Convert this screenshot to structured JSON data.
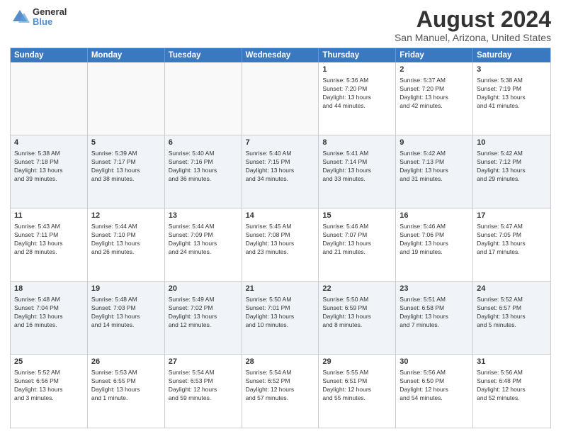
{
  "logo": {
    "line1": "General",
    "line2": "Blue"
  },
  "title": "August 2024",
  "location": "San Manuel, Arizona, United States",
  "header_days": [
    "Sunday",
    "Monday",
    "Tuesday",
    "Wednesday",
    "Thursday",
    "Friday",
    "Saturday"
  ],
  "weeks": [
    [
      {
        "day": "",
        "info": "",
        "empty": true
      },
      {
        "day": "",
        "info": "",
        "empty": true
      },
      {
        "day": "",
        "info": "",
        "empty": true
      },
      {
        "day": "",
        "info": "",
        "empty": true
      },
      {
        "day": "1",
        "info": "Sunrise: 5:36 AM\nSunset: 7:20 PM\nDaylight: 13 hours\nand 44 minutes."
      },
      {
        "day": "2",
        "info": "Sunrise: 5:37 AM\nSunset: 7:20 PM\nDaylight: 13 hours\nand 42 minutes."
      },
      {
        "day": "3",
        "info": "Sunrise: 5:38 AM\nSunset: 7:19 PM\nDaylight: 13 hours\nand 41 minutes."
      }
    ],
    [
      {
        "day": "4",
        "info": "Sunrise: 5:38 AM\nSunset: 7:18 PM\nDaylight: 13 hours\nand 39 minutes."
      },
      {
        "day": "5",
        "info": "Sunrise: 5:39 AM\nSunset: 7:17 PM\nDaylight: 13 hours\nand 38 minutes."
      },
      {
        "day": "6",
        "info": "Sunrise: 5:40 AM\nSunset: 7:16 PM\nDaylight: 13 hours\nand 36 minutes."
      },
      {
        "day": "7",
        "info": "Sunrise: 5:40 AM\nSunset: 7:15 PM\nDaylight: 13 hours\nand 34 minutes."
      },
      {
        "day": "8",
        "info": "Sunrise: 5:41 AM\nSunset: 7:14 PM\nDaylight: 13 hours\nand 33 minutes."
      },
      {
        "day": "9",
        "info": "Sunrise: 5:42 AM\nSunset: 7:13 PM\nDaylight: 13 hours\nand 31 minutes."
      },
      {
        "day": "10",
        "info": "Sunrise: 5:42 AM\nSunset: 7:12 PM\nDaylight: 13 hours\nand 29 minutes."
      }
    ],
    [
      {
        "day": "11",
        "info": "Sunrise: 5:43 AM\nSunset: 7:11 PM\nDaylight: 13 hours\nand 28 minutes."
      },
      {
        "day": "12",
        "info": "Sunrise: 5:44 AM\nSunset: 7:10 PM\nDaylight: 13 hours\nand 26 minutes."
      },
      {
        "day": "13",
        "info": "Sunrise: 5:44 AM\nSunset: 7:09 PM\nDaylight: 13 hours\nand 24 minutes."
      },
      {
        "day": "14",
        "info": "Sunrise: 5:45 AM\nSunset: 7:08 PM\nDaylight: 13 hours\nand 23 minutes."
      },
      {
        "day": "15",
        "info": "Sunrise: 5:46 AM\nSunset: 7:07 PM\nDaylight: 13 hours\nand 21 minutes."
      },
      {
        "day": "16",
        "info": "Sunrise: 5:46 AM\nSunset: 7:06 PM\nDaylight: 13 hours\nand 19 minutes."
      },
      {
        "day": "17",
        "info": "Sunrise: 5:47 AM\nSunset: 7:05 PM\nDaylight: 13 hours\nand 17 minutes."
      }
    ],
    [
      {
        "day": "18",
        "info": "Sunrise: 5:48 AM\nSunset: 7:04 PM\nDaylight: 13 hours\nand 16 minutes."
      },
      {
        "day": "19",
        "info": "Sunrise: 5:48 AM\nSunset: 7:03 PM\nDaylight: 13 hours\nand 14 minutes."
      },
      {
        "day": "20",
        "info": "Sunrise: 5:49 AM\nSunset: 7:02 PM\nDaylight: 13 hours\nand 12 minutes."
      },
      {
        "day": "21",
        "info": "Sunrise: 5:50 AM\nSunset: 7:01 PM\nDaylight: 13 hours\nand 10 minutes."
      },
      {
        "day": "22",
        "info": "Sunrise: 5:50 AM\nSunset: 6:59 PM\nDaylight: 13 hours\nand 8 minutes."
      },
      {
        "day": "23",
        "info": "Sunrise: 5:51 AM\nSunset: 6:58 PM\nDaylight: 13 hours\nand 7 minutes."
      },
      {
        "day": "24",
        "info": "Sunrise: 5:52 AM\nSunset: 6:57 PM\nDaylight: 13 hours\nand 5 minutes."
      }
    ],
    [
      {
        "day": "25",
        "info": "Sunrise: 5:52 AM\nSunset: 6:56 PM\nDaylight: 13 hours\nand 3 minutes."
      },
      {
        "day": "26",
        "info": "Sunrise: 5:53 AM\nSunset: 6:55 PM\nDaylight: 13 hours\nand 1 minute."
      },
      {
        "day": "27",
        "info": "Sunrise: 5:54 AM\nSunset: 6:53 PM\nDaylight: 12 hours\nand 59 minutes."
      },
      {
        "day": "28",
        "info": "Sunrise: 5:54 AM\nSunset: 6:52 PM\nDaylight: 12 hours\nand 57 minutes."
      },
      {
        "day": "29",
        "info": "Sunrise: 5:55 AM\nSunset: 6:51 PM\nDaylight: 12 hours\nand 55 minutes."
      },
      {
        "day": "30",
        "info": "Sunrise: 5:56 AM\nSunset: 6:50 PM\nDaylight: 12 hours\nand 54 minutes."
      },
      {
        "day": "31",
        "info": "Sunrise: 5:56 AM\nSunset: 6:48 PM\nDaylight: 12 hours\nand 52 minutes."
      }
    ]
  ]
}
